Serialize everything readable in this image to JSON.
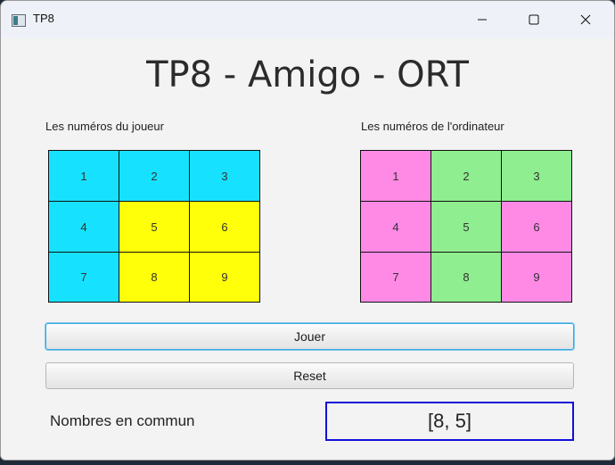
{
  "window": {
    "title": "TP8"
  },
  "heading": "TP8 - Amigo - ORT",
  "player": {
    "label": "Les numéros du joueur",
    "cells": [
      {
        "n": "1",
        "color": "#16e2ff"
      },
      {
        "n": "2",
        "color": "#16e2ff"
      },
      {
        "n": "3",
        "color": "#16e2ff"
      },
      {
        "n": "4",
        "color": "#16e2ff"
      },
      {
        "n": "5",
        "color": "#ffff0a"
      },
      {
        "n": "6",
        "color": "#ffff0a"
      },
      {
        "n": "7",
        "color": "#16e2ff"
      },
      {
        "n": "8",
        "color": "#ffff0a"
      },
      {
        "n": "9",
        "color": "#ffff0a"
      }
    ]
  },
  "computer": {
    "label": "Les numéros de l'ordinateur",
    "cells": [
      {
        "n": "1",
        "color": "#ff8ae6"
      },
      {
        "n": "2",
        "color": "#8fee8f"
      },
      {
        "n": "3",
        "color": "#8fee8f"
      },
      {
        "n": "4",
        "color": "#ff8ae6"
      },
      {
        "n": "5",
        "color": "#8fee8f"
      },
      {
        "n": "6",
        "color": "#ff8ae6"
      },
      {
        "n": "7",
        "color": "#ff8ae6"
      },
      {
        "n": "8",
        "color": "#8fee8f"
      },
      {
        "n": "9",
        "color": "#ff8ae6"
      }
    ]
  },
  "buttons": {
    "play": "Jouer",
    "reset": "Reset"
  },
  "common": {
    "label": "Nombres en commun",
    "value": "[8, 5]"
  }
}
